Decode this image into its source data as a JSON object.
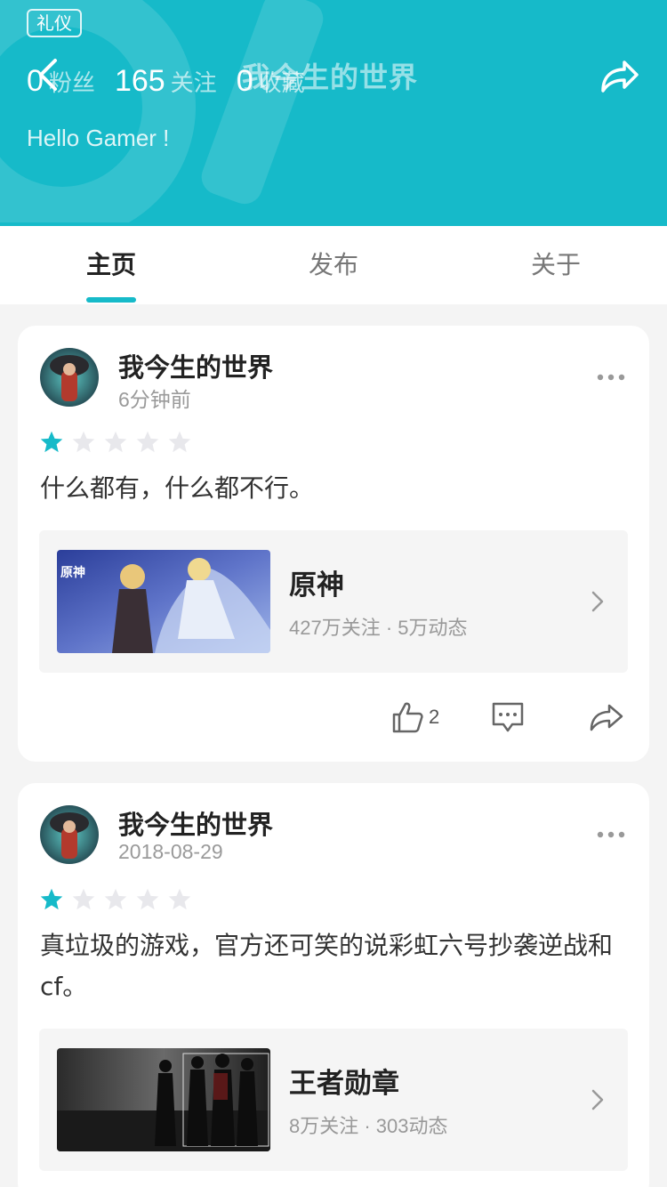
{
  "header": {
    "badge": "礼仪",
    "title": "我今生的世界",
    "stats": [
      {
        "num": "0",
        "label": "粉丝"
      },
      {
        "num": "165",
        "label": "关注"
      },
      {
        "num": "0",
        "label": "收藏"
      }
    ],
    "bio": "Hello Gamer !",
    "icons": {
      "back": "back-arrow-icon",
      "share": "share-icon"
    }
  },
  "tabs": [
    {
      "label": "主页",
      "active": true
    },
    {
      "label": "发布",
      "active": false
    },
    {
      "label": "关于",
      "active": false
    }
  ],
  "colors": {
    "accent": "#16bac9",
    "star_on": "#16bac9",
    "star_off": "#e8e8ec"
  },
  "posts": [
    {
      "author": "我今生的世界",
      "time": "6分钟前",
      "rating": 1,
      "rating_max": 5,
      "text": "什么都有，什么都不行。",
      "game": {
        "name": "原神",
        "meta": "427万关注 · 5万动态"
      },
      "likes": "2"
    },
    {
      "author": "我今生的世界",
      "time": "2018-08-29",
      "rating": 1,
      "rating_max": 5,
      "text": "真垃圾的游戏，官方还可笑的说彩虹六号抄袭逆战和cf。",
      "game": {
        "name": "王者勋章",
        "meta": "8万关注 · 303动态"
      }
    }
  ]
}
